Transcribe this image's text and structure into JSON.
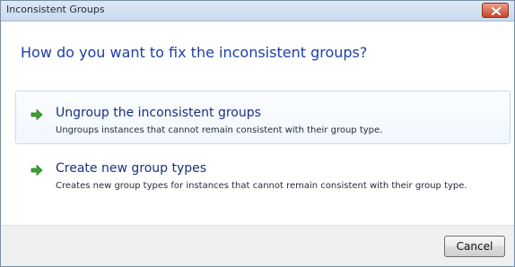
{
  "window": {
    "title": "Inconsistent Groups"
  },
  "dialog": {
    "question": "How do you want to fix the inconsistent groups?"
  },
  "options": [
    {
      "title": "Ungroup the inconsistent groups",
      "description": "Ungroups instances that cannot remain consistent with their group type.",
      "icon": "green-arrow-icon",
      "selected": true
    },
    {
      "title": "Create new group types",
      "description": "Creates new group types for instances that cannot remain consistent with their group type.",
      "icon": "green-arrow-icon",
      "selected": false
    }
  ],
  "footer": {
    "cancel_label": "Cancel"
  },
  "colors": {
    "heading": "#1d3fa8",
    "arrow": "#3aa12f",
    "close_button": "#c7452b"
  }
}
